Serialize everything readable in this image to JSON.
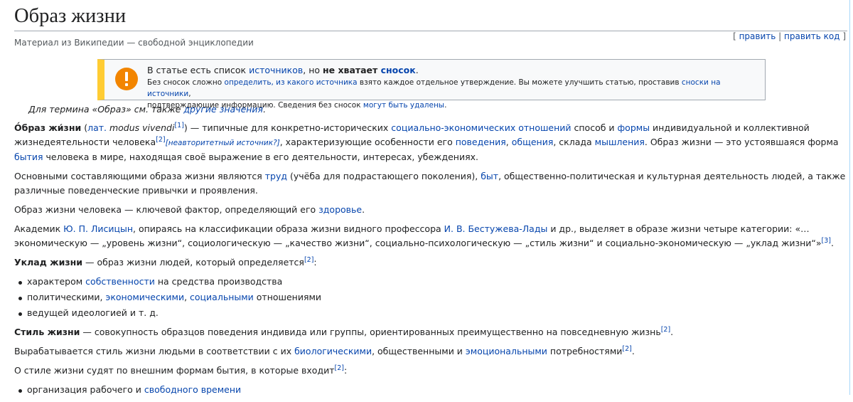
{
  "title": "Образ жизни",
  "subtitle": "Материал из Википедии — свободной энциклопедии",
  "edit": {
    "open": "[",
    "edit": "править",
    "sep": "|",
    "edit_code": "править код",
    "close": "]"
  },
  "ambox": {
    "main_1": "В статье есть список ",
    "main_link1": "источников",
    "main_2": ", но ",
    "main_bold": "не хватает ",
    "main_link2": "сносок",
    "main_3": ".",
    "small_1": "Без сносок сложно ",
    "small_link1": "определить, из какого источника",
    "small_2": " взято каждое отдельное утверждение. Вы можете улучшить статью, проставив ",
    "small_link2": "сноски на источники",
    "small_3": ",",
    "small_4": "подтверждающие информацию. Сведения без сносок ",
    "small_link3": "могут быть удалены",
    "small_5": ".",
    "icon_color": "#f28500"
  },
  "hatnote": {
    "text": "Для термина «Образ» см. также ",
    "link": "другие значения",
    "end": "."
  },
  "p1": {
    "term": "О́браз жи́зни",
    "t1": " (",
    "lang": "лат.",
    "t2": " ",
    "latin": "modus vivendi",
    "ref1": "[1]",
    "t3": ") — типичные для конкретно-исторических ",
    "l1": "социально-экономических отношений",
    "t4": " способ и ",
    "l2": "формы",
    "t5": " индивидуальной и коллективной жизнедеятельности человека",
    "ref2": "[2]",
    "unreliable": "[неавторитетный источник?]",
    "t6": ", характеризующие особенности его ",
    "l3": "поведения",
    "t7": ", ",
    "l4": "общения",
    "t8": ", склада ",
    "l5": "мышления",
    "t9": ". Образ жизни — это устоявшаяся форма ",
    "l6": "бытия",
    "t10": " человека в мире, находящая своё выражение в его деятельности, интересах, убеждениях."
  },
  "p2": {
    "t1": "Основными составляющими образа жизни являются ",
    "l1": "труд",
    "t2": " (учёба для подрастающего поколения), ",
    "l2": "быт",
    "t3": ", общественно-политическая и культурная деятельность людей, а также различные поведенческие привычки и проявления."
  },
  "p3": {
    "t1": "Образ жизни человека — ключевой фактор, определяющий его ",
    "l1": "здоровье",
    "t2": "."
  },
  "p4": {
    "t1": "Академик ",
    "l1": "Ю. П. Лисицын",
    "t2": ", опираясь на классификации образа жизни видного профессора ",
    "l2": "И. В. Бестужева-Лады",
    "t3": " и др., выделяет в образе жизни четыре категории: «… экономическую — „уровень жизни“, социологическую — „качество жизни“, социально-психологическую — „стиль жизни“ и социально-экономическую — „уклад жизни“»",
    "ref": "[3]",
    "t4": "."
  },
  "p5": {
    "bold": "Уклад жизни",
    "t1": " — образ жизни людей, который определяется",
    "ref": "[2]",
    "t2": ":"
  },
  "list1": {
    "i1_a": "характером ",
    "i1_l": "собственности",
    "i1_b": " на средства производства",
    "i2_a": "политическими, ",
    "i2_l1": "экономическими",
    "i2_b": ", ",
    "i2_l2": "социальными",
    "i2_c": " отношениями",
    "i3": "ведущей идеологией и т. д."
  },
  "p6": {
    "bold": "Стиль жизни",
    "t1": " — совокупность образцов поведения индивида или группы, ориентированных преимущественно на повседневную жизнь",
    "ref": "[2]",
    "t2": "."
  },
  "p7": {
    "t1": "Вырабатывается стиль жизни людьми в соответствии с их ",
    "l1": "биологическими",
    "t2": ", общественными и ",
    "l2": "эмоциональными",
    "t3": " потребностями",
    "ref": "[2]",
    "t4": "."
  },
  "p8": {
    "t1": "О стиле жизни судят по внешним формам бытия, в которые входит",
    "ref": "[2]",
    "t2": ":"
  },
  "list2": {
    "i1_a": "организация рабочего и ",
    "i1_l": "свободного времени"
  }
}
